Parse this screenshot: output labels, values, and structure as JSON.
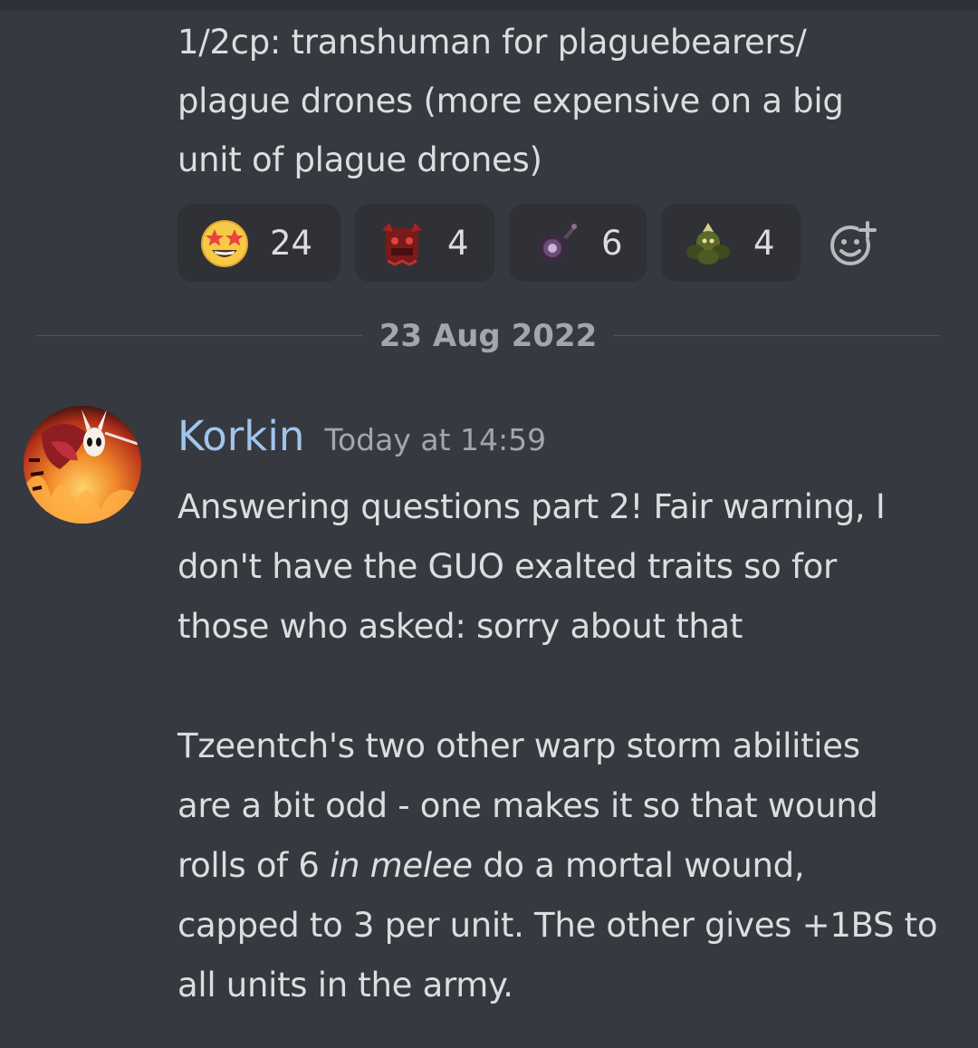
{
  "previous_message": {
    "lines": [
      "1/2cp: transhuman for plaguebearers/",
      "plague drones (more expensive on a big",
      "unit of plague drones)"
    ]
  },
  "reactions": [
    {
      "icon": "star-struck-emoji-icon",
      "count": "24"
    },
    {
      "icon": "red-demon-engine-icon",
      "count": "4"
    },
    {
      "icon": "dark-orb-icon",
      "count": "6"
    },
    {
      "icon": "nurgle-marine-icon",
      "count": "4"
    }
  ],
  "add_reaction_icon": "add-reaction-icon",
  "date_divider": "23 Aug 2022",
  "message": {
    "author": "Korkin",
    "timestamp": "Today at 14:59",
    "paragraph1": [
      "Answering questions part 2! Fair warning, I",
      "don't have the GUO exalted traits so for",
      "those who asked: sorry about that"
    ],
    "paragraph2": {
      "line1": "Tzeentch's two other warp storm abilities",
      "line2": "are a bit odd - one makes it so that wound",
      "line3_before": "rolls of 6 ",
      "line3_italic": "in melee",
      "line3_after": " do a mortal wound,",
      "line4": "capped to 3 per unit. The other gives +1BS to",
      "line5": "all units in the army."
    }
  },
  "colors": {
    "background": "#36393f",
    "reaction_bg": "#2f3136",
    "username": "#a0c4ee",
    "text": "#dcddde",
    "muted": "#a3a6aa"
  }
}
